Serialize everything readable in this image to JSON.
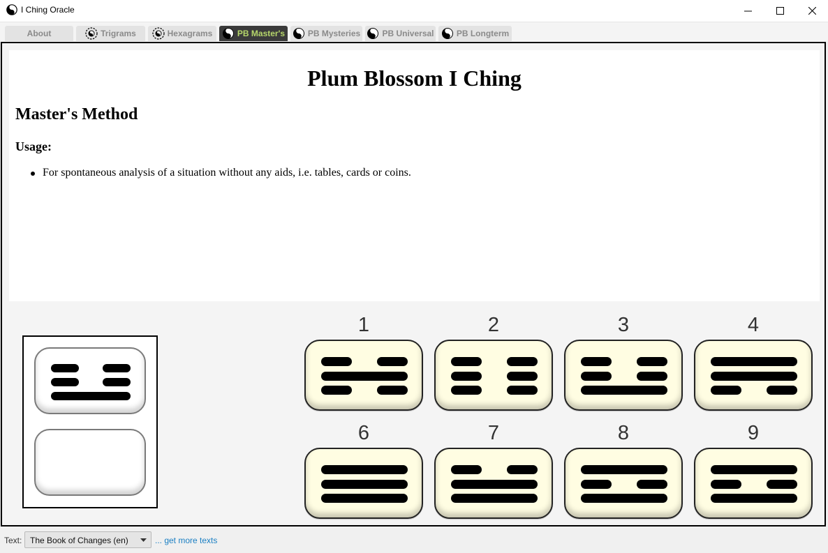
{
  "window": {
    "title": "I Ching Oracle",
    "controls": [
      "minimize",
      "maximize",
      "close"
    ]
  },
  "tabs": [
    {
      "label": "About",
      "icon": "none",
      "active": false
    },
    {
      "label": "Trigrams",
      "icon": "bagua-icon",
      "active": false
    },
    {
      "label": "Hexagrams",
      "icon": "bagua-icon",
      "active": false
    },
    {
      "label": "PB Master's",
      "icon": "yin-yang-icon",
      "active": true
    },
    {
      "label": "PB Mysteries",
      "icon": "yin-yang-icon",
      "active": false
    },
    {
      "label": "PB Universal",
      "icon": "yin-yang-icon",
      "active": false
    },
    {
      "label": "PB Longterm",
      "icon": "yin-yang-icon",
      "active": false
    }
  ],
  "document": {
    "title": "Plum Blossom I Ching",
    "subtitle": "Master's Method",
    "usage_heading": "Usage:",
    "usage_items": [
      "For spontaneous analysis of a situation without any aids, i.e. tables, cards or coins."
    ]
  },
  "selection": {
    "upper_trigram_lines": [
      "broken",
      "broken",
      "solid"
    ],
    "lower_trigram_lines": []
  },
  "trigram_buttons": [
    {
      "number": "1",
      "lines": [
        "broken",
        "solid",
        "broken"
      ]
    },
    {
      "number": "2",
      "lines": [
        "broken",
        "broken",
        "broken"
      ]
    },
    {
      "number": "3",
      "lines": [
        "broken",
        "broken",
        "solid"
      ]
    },
    {
      "number": "4",
      "lines": [
        "solid",
        "solid",
        "broken"
      ]
    },
    {
      "number": "6",
      "lines": [
        "solid",
        "solid",
        "solid"
      ]
    },
    {
      "number": "7",
      "lines": [
        "broken",
        "solid",
        "solid"
      ]
    },
    {
      "number": "8",
      "lines": [
        "solid",
        "broken",
        "solid"
      ]
    },
    {
      "number": "9",
      "lines": [
        "solid",
        "broken",
        "solid"
      ]
    }
  ],
  "status": {
    "label": "Text:",
    "selected_text": "The Book of Changes (en)",
    "more_link": "... get more texts"
  },
  "colors": {
    "active_tab_bg": "#3b3b3b",
    "active_tab_text": "#b6d66b",
    "trigram_bg": "#fffde2",
    "link": "#1a7fc3"
  }
}
